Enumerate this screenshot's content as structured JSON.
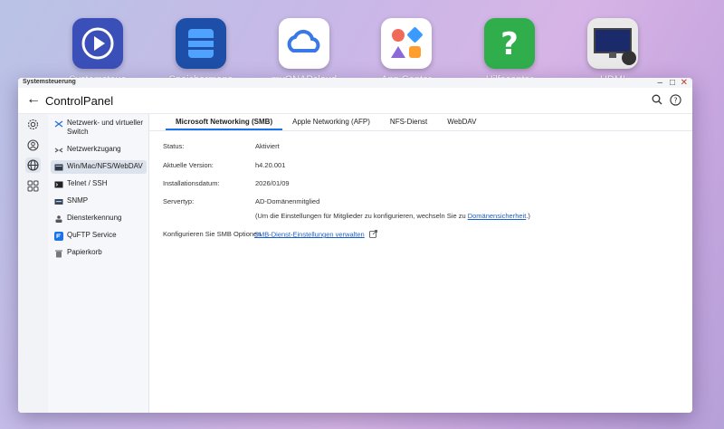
{
  "desktop": {
    "icons": [
      {
        "label": "Systemsteue",
        "color": "#3b4fb8"
      },
      {
        "label": "Speichermana",
        "color": "#2a6fd6"
      },
      {
        "label": "myQNAPcloud",
        "color": "#ffffff"
      },
      {
        "label": "App Center",
        "color": "#ffffff"
      },
      {
        "label": "Hilfecenter",
        "color": "#2fae4b"
      },
      {
        "label": "HDMI",
        "color": "#e9e9e9"
      }
    ]
  },
  "window": {
    "title": "Systemsteuerung",
    "app_title": "ControlPanel"
  },
  "sidebar": {
    "items": [
      {
        "label": "Netzwerk- und virtueller Switch",
        "icon": "network-switch-icon"
      },
      {
        "label": "Netzwerkzugang",
        "icon": "network-access-icon"
      },
      {
        "label": "Win/Mac/NFS/WebDAV",
        "icon": "win-mac-icon"
      },
      {
        "label": "Telnet / SSH",
        "icon": "terminal-icon"
      },
      {
        "label": "SNMP",
        "icon": "snmp-icon"
      },
      {
        "label": "Diensterkennung",
        "icon": "service-discovery-icon"
      },
      {
        "label": "QuFTP Service",
        "icon": "ftp-icon"
      },
      {
        "label": "Papierkorb",
        "icon": "trash-icon"
      }
    ]
  },
  "tabs": [
    {
      "label": "Microsoft Networking (SMB)"
    },
    {
      "label": "Apple Networking (AFP)"
    },
    {
      "label": "NFS-Dienst"
    },
    {
      "label": "WebDAV"
    }
  ],
  "fields": {
    "status_label": "Status:",
    "status_value": "Aktiviert",
    "version_label": "Aktuelle Version:",
    "version_value": "h4.20.001",
    "install_label": "Installationsdatum:",
    "install_value": "2026/01/09",
    "servertype_label": "Servertyp:",
    "servertype_value": "AD-Domänenmitglied",
    "hint_prefix": "(Um die Einstellungen für Mitglieder zu konfigurieren, wechseln Sie zu ",
    "hint_link": "Domänensicherheit",
    "hint_suffix": ".)",
    "configure_label": "Konfigurieren Sie SMB Optionen",
    "configure_link": "SMB-Dienst-Einstellungen verwalten"
  },
  "colors": {
    "accent": "#1a73e8",
    "link": "#1a5fc9"
  }
}
